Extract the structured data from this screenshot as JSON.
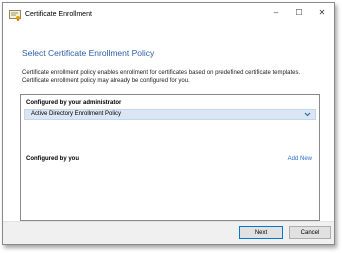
{
  "window": {
    "title": "Certificate Enrollment",
    "title_icon": "certificate-icon",
    "controls": {
      "minimize": "–",
      "maximize": "☐",
      "close": "✕"
    }
  },
  "main": {
    "heading": "Select Certificate Enrollment Policy",
    "description": "Certificate enrollment policy enables enrollment for certificates based on predefined certificate templates. Certificate enrollment policy may already be configured for you."
  },
  "panel": {
    "admin_label": "Configured by your administrator",
    "policy_name": "Active Directory Enrollment Policy",
    "expand_icon": "chevron-down-icon",
    "you_label": "Configured by you",
    "add_new": "Add New"
  },
  "footer": {
    "next_label": "Next",
    "cancel_label": "Cancel"
  },
  "colors": {
    "heading": "#2a5ea8",
    "link": "#2a6fd1",
    "selected_row": "#dbe6f4"
  }
}
